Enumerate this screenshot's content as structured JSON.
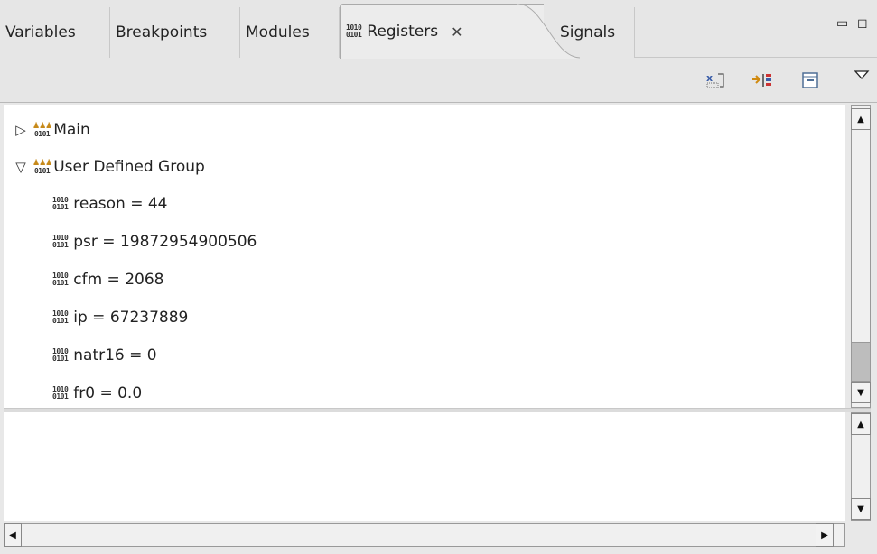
{
  "tabs": [
    {
      "label": "Variables"
    },
    {
      "label": "Breakpoints"
    },
    {
      "label": "Modules"
    },
    {
      "label": "Registers",
      "active": true,
      "icon": "register-bits-icon"
    },
    {
      "label": "Signals"
    }
  ],
  "tab_icon_bits": [
    "1010",
    "0101"
  ],
  "tab_close": "✕",
  "window_controls": {
    "minimize": "▭",
    "maximize": "◻"
  },
  "toolbar": {
    "icons": [
      "format-icon",
      "change-value-icon",
      "collapse-all-icon",
      "view-menu-icon"
    ]
  },
  "tree": {
    "groups": [
      {
        "label": "Main",
        "expanded": false,
        "twisty": "▷"
      },
      {
        "label": "User Defined Group",
        "expanded": true,
        "twisty": "▽"
      }
    ],
    "registers": [
      {
        "label": "reason = 44"
      },
      {
        "label": "psr = 19872954900506"
      },
      {
        "label": "cfm = 2068"
      },
      {
        "label": "ip = 67237889"
      },
      {
        "label": "natr16 = 0"
      },
      {
        "label": "fr0 = 0.0"
      }
    ]
  },
  "scroll": {
    "up": "▲",
    "down": "▼",
    "left": "◀",
    "right": "▶"
  },
  "colors": {
    "active_tab": "#ececec",
    "tree_bg": "#ffffff",
    "thumb": "#bdbdbd"
  }
}
